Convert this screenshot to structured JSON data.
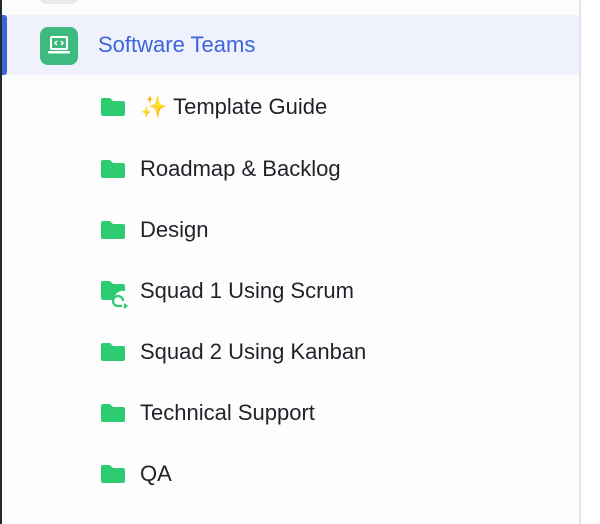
{
  "active_space": {
    "label": "Software Teams",
    "icon": "laptop-code-icon",
    "color": "#3d63dd"
  },
  "folders": [
    {
      "label": "✨ Template Guide",
      "icon": "folder-icon"
    },
    {
      "label": "Roadmap & Backlog",
      "icon": "folder-icon"
    },
    {
      "label": "Design",
      "icon": "folder-icon"
    },
    {
      "label": "Squad 1 Using Scrum",
      "icon": "folder-sprint-icon"
    },
    {
      "label": "Squad 2 Using Kanban",
      "icon": "folder-icon"
    },
    {
      "label": "Technical Support",
      "icon": "folder-icon"
    },
    {
      "label": "QA",
      "icon": "folder-icon"
    }
  ],
  "colors": {
    "folder": "#2ecc71",
    "accent": "#3d63dd",
    "active_bg": "#eff2fc"
  }
}
